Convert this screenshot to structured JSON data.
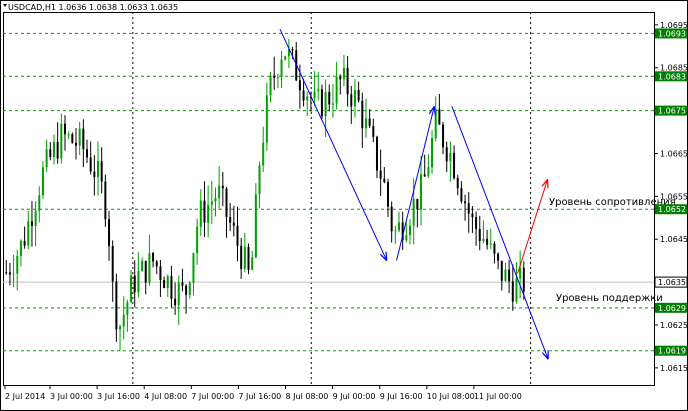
{
  "chart_data": {
    "type": "candlestick",
    "header": {
      "symbol": "USDCAD,H1",
      "open": "1.0636",
      "high": "1.0638",
      "low": "1.0633",
      "close": "1.0635"
    },
    "y_range": [
      1.0611,
      1.0698
    ],
    "y_ticks": [
      "1.0695",
      "1.0685",
      "1.0675",
      "1.0665",
      "1.0655",
      "1.0645",
      "1.0635",
      "1.0625",
      "1.0615"
    ],
    "levels": [
      {
        "value": 1.0693,
        "label": "1.0693"
      },
      {
        "value": 1.0683,
        "label": "1.0683"
      },
      {
        "value": 1.0675,
        "label": "1.0675"
      },
      {
        "value": 1.0652,
        "label": "1.0652"
      },
      {
        "value": 1.0629,
        "label": "1.0629"
      },
      {
        "value": 1.0619,
        "label": "1.0619"
      }
    ],
    "current_price": {
      "value": 1.0635,
      "label": "1.0635"
    },
    "x_labels": [
      "2 Jul 2014",
      "3 Jul 00:00",
      "3 Jul 16:00",
      "4 Jul 08:00",
      "7 Jul 00:00",
      "7 Jul 16:00",
      "8 Jul 08:00",
      "9 Jul 00:00",
      "9 Jul 16:00",
      "10 Jul 08:00",
      "11 Jul 00:00"
    ],
    "annotations": {
      "resistance": "Уровень сопротивления",
      "support": "Уровень поддержки"
    },
    "trendlines": [
      {
        "from": [
          0.4255,
          1.0694
        ],
        "to": [
          0.5895,
          1.064
        ],
        "color": "#0000ff"
      },
      {
        "from": [
          0.6045,
          1.064
        ],
        "to": [
          0.6625,
          1.0676
        ],
        "color": "#0000ff"
      },
      {
        "from": [
          0.6895,
          1.0676
        ],
        "to": [
          0.8375,
          1.0617
        ],
        "color": "#0000ff"
      },
      {
        "from": [
          0.7905,
          1.0637
        ],
        "to": [
          0.8365,
          1.0659
        ],
        "color": "#ff0000"
      }
    ],
    "vlines": [
      0.1995,
      0.4735,
      0.8105
    ],
    "colors": {
      "bull": "#00a000",
      "bear": "#000000",
      "level_line": "#00a000",
      "level_badge": "#008000",
      "grid": "#c8c8c8",
      "support_resistance_trend": "#0000ff",
      "projection": "#ff0000"
    }
  }
}
